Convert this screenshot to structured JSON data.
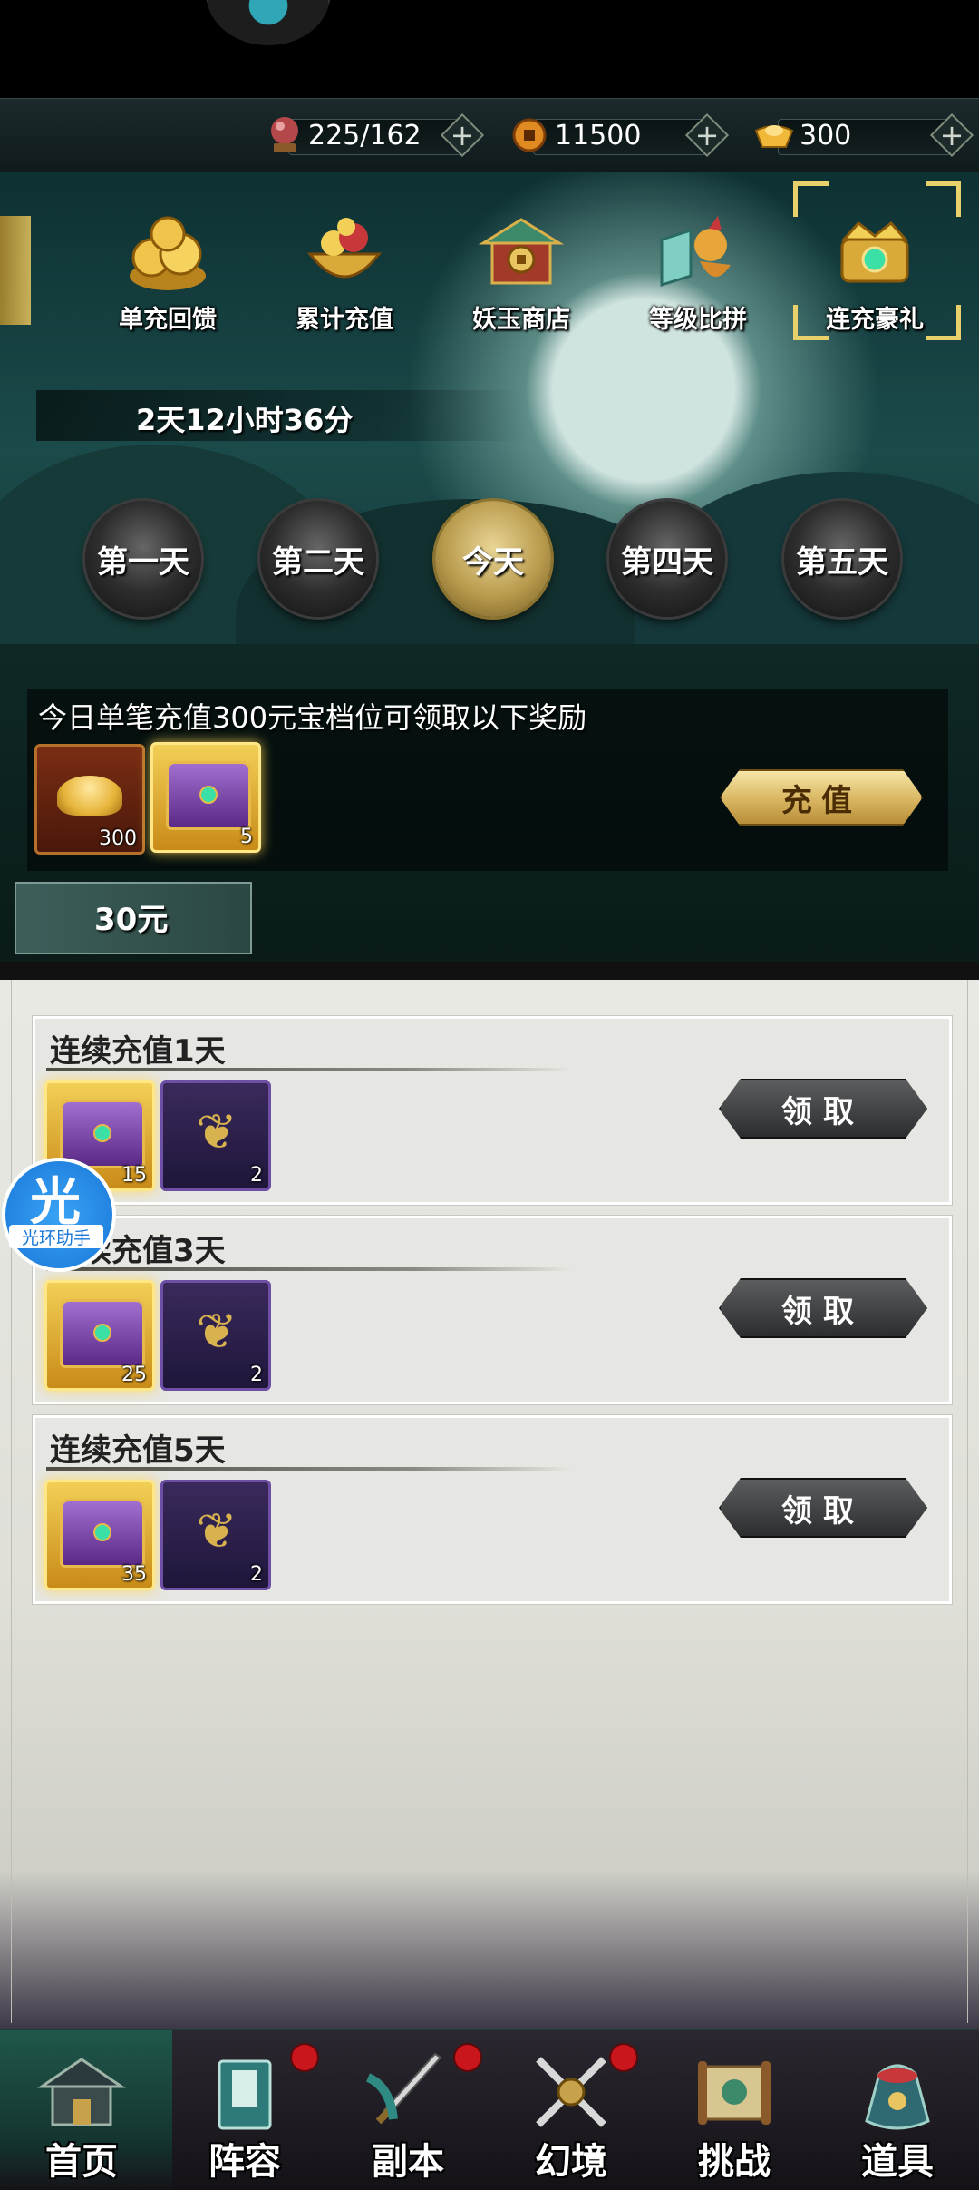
{
  "resources": [
    {
      "name": "stamina",
      "icon": "red-orb-icon",
      "value": "225/162"
    },
    {
      "name": "coins",
      "icon": "copper-coin-icon",
      "value": "11500"
    },
    {
      "name": "ingots",
      "icon": "gold-ingot-icon",
      "value": "300"
    }
  ],
  "event_tabs": [
    {
      "label": "单充回馈",
      "icon": "coin-pile-icon"
    },
    {
      "label": "累计充值",
      "icon": "treasure-bowl-icon"
    },
    {
      "label": "妖玉商店",
      "icon": "jade-shop-icon"
    },
    {
      "label": "等级比拼",
      "icon": "bird-banner-icon"
    },
    {
      "label": "连充豪礼",
      "icon": "crown-chest-icon",
      "selected": true
    }
  ],
  "timer": "2天12小时36分",
  "days": [
    {
      "label": "第一天",
      "active": false
    },
    {
      "label": "第二天",
      "active": false
    },
    {
      "label": "今天",
      "active": true
    },
    {
      "label": "第四天",
      "active": false
    },
    {
      "label": "第五天",
      "active": false
    }
  ],
  "today_reward": {
    "description": "今日单笔充值300元宝档位可领取以下奖励",
    "items": [
      {
        "type": "gold-ingot",
        "qty": "300"
      },
      {
        "type": "chest",
        "qty": "5"
      }
    ],
    "button": "充值"
  },
  "tier": "30元",
  "streak_rewards": [
    {
      "title": "连续充值1天",
      "items": [
        {
          "type": "chest",
          "qty": "15"
        },
        {
          "type": "fan",
          "qty": "2"
        }
      ],
      "button": "领取"
    },
    {
      "title": "连续充值3天",
      "items": [
        {
          "type": "chest",
          "qty": "25"
        },
        {
          "type": "fan",
          "qty": "2"
        }
      ],
      "button": "领取"
    },
    {
      "title": "连续充值5天",
      "items": [
        {
          "type": "chest",
          "qty": "35"
        },
        {
          "type": "fan",
          "qty": "2"
        }
      ],
      "button": "领取"
    }
  ],
  "helper": {
    "glyph": "光",
    "label": "光环助手"
  },
  "nav": [
    {
      "label": "首页",
      "icon": "palace-icon",
      "badge": false
    },
    {
      "label": "阵容",
      "icon": "book-icon",
      "badge": true
    },
    {
      "label": "副本",
      "icon": "sword-icon",
      "badge": true
    },
    {
      "label": "幻境",
      "icon": "crossed-swords-icon",
      "badge": true
    },
    {
      "label": "挑战",
      "icon": "scroll-icon",
      "badge": false
    },
    {
      "label": "道具",
      "icon": "bag-icon",
      "badge": false
    }
  ]
}
